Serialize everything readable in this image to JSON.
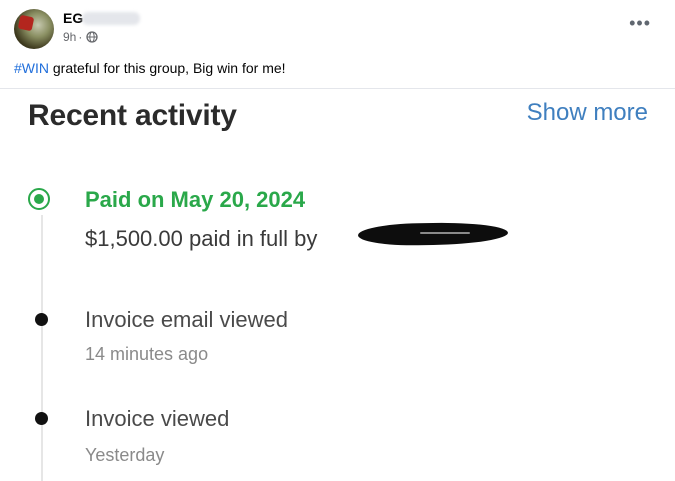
{
  "post": {
    "author": "EG",
    "time": "9h",
    "separator": "·",
    "privacy_icon": "globe-icon",
    "more_icon": "ellipsis-icon",
    "more_label": "•••",
    "hashtag": "#WIN",
    "caption": " grateful for this group, Big win for me!"
  },
  "activity": {
    "title": "Recent activity",
    "show_more": "Show more",
    "items": [
      {
        "title": "Paid on May 20, 2024",
        "detail": "$1,500.00 paid in full by",
        "status_color": "#2aa84a"
      },
      {
        "title": "Invoice email viewed",
        "time": "14 minutes ago"
      },
      {
        "title": "Invoice viewed",
        "time": "Yesterday"
      }
    ]
  },
  "colors": {
    "hashtag": "#216fdb",
    "link": "#3f7fbf",
    "paid": "#2aa84a"
  }
}
